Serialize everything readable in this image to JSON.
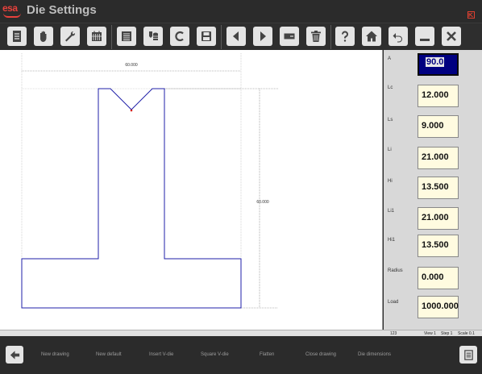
{
  "app": {
    "logo_text": "esa",
    "title": "Die Settings",
    "kb_icon": "keyboard-icon"
  },
  "toolbar": {
    "icons": [
      "document-icon",
      "hand-icon",
      "wrench-icon",
      "calendar-grid-icon",
      "list-stack-icon",
      "database-down-icon",
      "c-icon",
      "save-icon",
      "arrow-left-icon",
      "arrow-right-icon",
      "rectangle-minus-icon",
      "trash-icon",
      "help-icon",
      "home-icon",
      "undo-icon",
      "minimize-icon",
      "close-icon"
    ]
  },
  "drawing": {
    "top_dimension": "60.000",
    "side_dimension": "60.000",
    "outline_color": "#1f1fa8",
    "point_color": "#d02020"
  },
  "fields": [
    {
      "label": "A",
      "value": "90.0",
      "active": true
    },
    {
      "label": "Lc",
      "value": "12.000"
    },
    {
      "label": "Ls",
      "value": "9.000"
    },
    {
      "label": "Li",
      "value": "21.000"
    },
    {
      "label": "Hi",
      "value": "13.500"
    },
    {
      "label": "Li1",
      "value": "21.000"
    },
    {
      "label": "Hi1",
      "value": "13.500"
    },
    {
      "label": "Radius",
      "value": "0.000"
    },
    {
      "label": "Load",
      "value": "1000.000"
    }
  ],
  "status": {
    "code": "123",
    "view": "View 1",
    "step": "Step 1",
    "scale": "Scale 0.1"
  },
  "bottom": {
    "back_icon": "arrow-left-icon",
    "menu_icon": "list-icon",
    "labels": [
      "New drawing",
      "New default",
      "Insert V-die",
      "Square V-die",
      "Flatten",
      "Close drawing",
      "Die dimensions"
    ]
  },
  "colors": {
    "active_field_bg": "#000080",
    "field_bg": "#fffbe0",
    "brand": "#e8413c"
  }
}
